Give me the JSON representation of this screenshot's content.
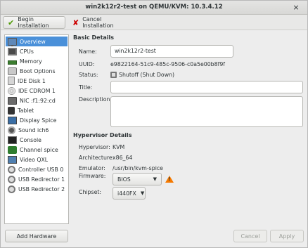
{
  "window": {
    "title": "win2k12r2-test on QEMU/KVM: 10.3.4.12",
    "close_glyph": "×"
  },
  "toolbar": {
    "begin_label": "Begin Installation",
    "cancel_label": "Cancel Installation"
  },
  "sidebar": {
    "items": [
      {
        "label": "Overview",
        "icon": "monitor-icon",
        "selected": true
      },
      {
        "label": "CPUs",
        "icon": "cpu-icon"
      },
      {
        "label": "Memory",
        "icon": "memory-icon"
      },
      {
        "label": "Boot Options",
        "icon": "boot-icon"
      },
      {
        "label": "IDE Disk 1",
        "icon": "disk-icon"
      },
      {
        "label": "IDE CDROM 1",
        "icon": "cdrom-icon"
      },
      {
        "label": "NIC :f1:92:cd",
        "icon": "nic-icon"
      },
      {
        "label": "Tablet",
        "icon": "tablet-icon"
      },
      {
        "label": "Display Spice",
        "icon": "display-icon"
      },
      {
        "label": "Sound ich6",
        "icon": "sound-icon"
      },
      {
        "label": "Console",
        "icon": "console-icon"
      },
      {
        "label": "Channel spice",
        "icon": "channel-icon"
      },
      {
        "label": "Video QXL",
        "icon": "video-icon"
      },
      {
        "label": "Controller USB 0",
        "icon": "usb-controller-icon"
      },
      {
        "label": "USB Redirector 1",
        "icon": "usb-redirector-icon"
      },
      {
        "label": "USB Redirector 2",
        "icon": "usb-redirector-icon"
      }
    ],
    "add_hardware_label": "Add Hardware"
  },
  "basic": {
    "heading": "Basic Details",
    "name_label": "Name:",
    "name_value": "win2k12r2-test",
    "uuid_label": "UUID:",
    "uuid_value": "e9822164-51c9-485c-9506-c0a5e00b8f9f",
    "status_label": "Status:",
    "status_value": "Shutoff (Shut Down)",
    "title_label": "Title:",
    "title_value": "",
    "description_label": "Description:"
  },
  "hypervisor": {
    "heading": "Hypervisor Details",
    "hypervisor_label": "Hypervisor:",
    "hypervisor_value": "KVM",
    "arch_label": "Architecture:",
    "arch_value": "x86_64",
    "emulator_label": "Emulator:",
    "emulator_value": "/usr/bin/kvm-spice",
    "firmware_label": "Firmware:",
    "firmware_value": "BIOS",
    "chipset_label": "Chipset:",
    "chipset_value": "i440FX"
  },
  "footer": {
    "cancel_label": "Cancel",
    "apply_label": "Apply"
  },
  "colors": {
    "selection": "#4a90d9",
    "warning": "#f57900"
  }
}
